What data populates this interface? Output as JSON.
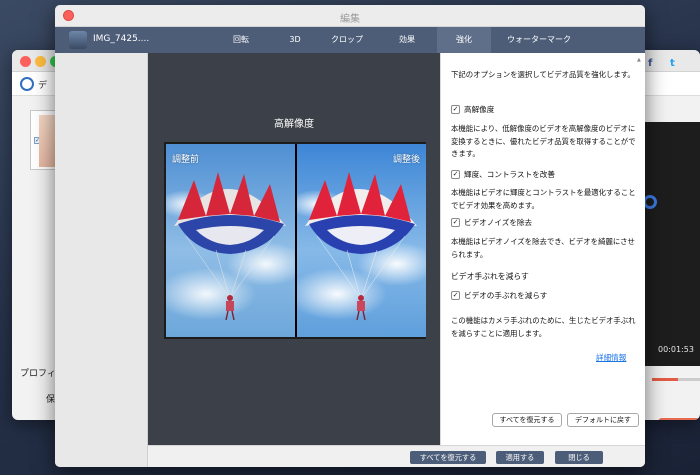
{
  "background_window": {
    "toolbar_title": "デ",
    "profile_label": "プロフィ",
    "profile_label_2": "保",
    "time": "00:01:53",
    "progress": 0.55,
    "social": [
      "f",
      "t"
    ]
  },
  "dialog": {
    "title": "編集",
    "file_name": "IMG_7425....",
    "tabs": [
      {
        "label": "回転",
        "active": false
      },
      {
        "label": "3D",
        "active": false
      },
      {
        "label": "クロップ",
        "active": false
      },
      {
        "label": "効果",
        "active": false
      },
      {
        "label": "強化",
        "active": true
      },
      {
        "label": "ウォーターマーク",
        "active": false
      }
    ],
    "preview": {
      "title": "高解像度",
      "before_label": "調整前",
      "after_label": "調整後"
    },
    "options": {
      "intro": "下記のオプションを選択してビデオ品質を強化します。",
      "upscale": {
        "label": "高解像度",
        "checked": true,
        "desc": "本機能により、低解像度のビデオを高解像度のビデオに変換するときに、優れたビデオ品質を取得することができます。"
      },
      "brightness": {
        "label": "輝度、コントラストを改善",
        "checked": true,
        "desc": "本機能はビデオに輝度とコントラストを最適化することでビデオ効果を高めます。"
      },
      "denoise": {
        "label": "ビデオノイズを除去",
        "checked": true,
        "desc": "本機能はビデオノイズを除去でき、ビデオを綺麗にさせられます。"
      },
      "shake": {
        "heading": "ビデオ手ぶれを減らす",
        "label": "ビデオの手ぶれを減らす",
        "checked": true,
        "desc": "この機能はカメラ手ぶれのために、生じたビデオ手ぶれを減らすことに適用します。"
      },
      "detail_link": "詳細情報",
      "restore_all": "すべてを復元する",
      "reset_default": "デフォルトに戻す"
    },
    "footer": {
      "restore_all": "すべてを復元する",
      "apply": "適用する",
      "close": "閉じる"
    }
  }
}
